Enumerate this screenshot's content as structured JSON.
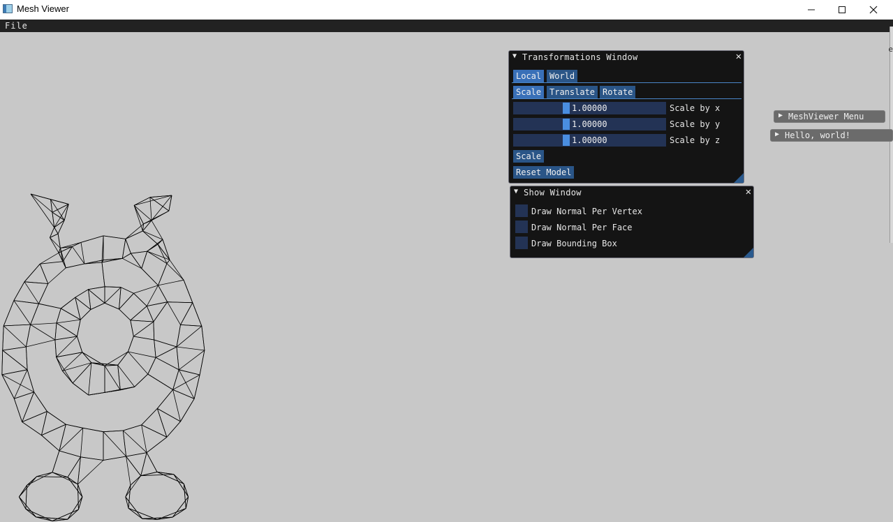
{
  "window": {
    "title": "Mesh Viewer"
  },
  "menubar": {
    "file": "File"
  },
  "transformations_window": {
    "title": "Transformations Window",
    "space_tabs": [
      "Local",
      "World"
    ],
    "op_tabs": [
      "Scale",
      "Translate",
      "Rotate"
    ],
    "sliders": [
      {
        "value": "1.00000",
        "label": "Scale by x"
      },
      {
        "value": "1.00000",
        "label": "Scale by y"
      },
      {
        "value": "1.00000",
        "label": "Scale by z"
      }
    ],
    "scale_button": "Scale",
    "reset_button": "Reset Model"
  },
  "show_window": {
    "title": "Show Window",
    "checkboxes": [
      {
        "label": "Draw Normal Per Vertex",
        "checked": false
      },
      {
        "label": "Draw Normal Per Face",
        "checked": false
      },
      {
        "label": "Draw Bounding Box",
        "checked": false
      }
    ]
  },
  "collapsed_windows": {
    "meshviewer_menu": "MeshViewer Menu",
    "hello_world": "Hello, world!"
  },
  "edge_text": "e",
  "colors": {
    "background": "#c8c8c8",
    "window_bg": "#141414",
    "button": "#2a5587",
    "button_active": "#3970b8",
    "frame_bg": "#233355"
  }
}
